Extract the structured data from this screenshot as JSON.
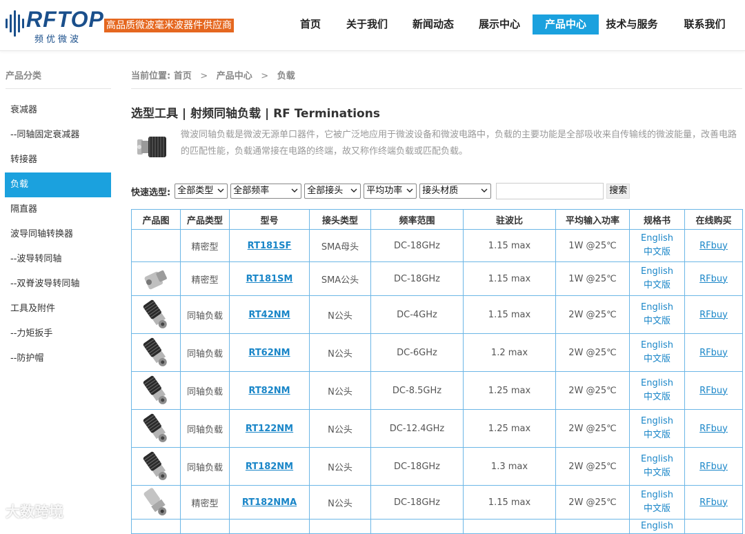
{
  "brand": {
    "logo_text": "RFTOP",
    "logo_sub": "频优微波",
    "slogan": "高品质微波毫米波器件供应商"
  },
  "nav": [
    {
      "label": "首页",
      "active": false
    },
    {
      "label": "关于我们",
      "active": false
    },
    {
      "label": "新闻动态",
      "active": false
    },
    {
      "label": "展示中心",
      "active": false
    },
    {
      "label": "产品中心",
      "active": true
    },
    {
      "label": "技术与服务",
      "active": false
    },
    {
      "label": "联系我们",
      "active": false
    }
  ],
  "sidebar": {
    "title": "产品分类",
    "items": [
      {
        "label": "衰减器",
        "active": false
      },
      {
        "label": "--同轴固定衰减器",
        "active": false
      },
      {
        "label": "转接器",
        "active": false
      },
      {
        "label": "负载",
        "active": true
      },
      {
        "label": "隔直器",
        "active": false
      },
      {
        "label": "波导同轴转换器",
        "active": false
      },
      {
        "label": "--波导转同轴",
        "active": false
      },
      {
        "label": "--双脊波导转同轴",
        "active": false
      },
      {
        "label": "工具及附件",
        "active": false
      },
      {
        "label": "--力矩扳手",
        "active": false
      },
      {
        "label": "--防护帽",
        "active": false
      }
    ]
  },
  "breadcrumb": {
    "prefix": "当前位置:",
    "items": [
      "首页",
      "产品中心",
      "负载"
    ],
    "separator": ">"
  },
  "page": {
    "title": "选型工具 | 射频同轴负载 | RF Terminations",
    "intro": "微波同轴负载是微波无源单口器件，它被广泛地应用于微波设备和微波电路中，负载的主要功能是全部吸收来自传输线的微波能量，改善电路的匹配性能，负载通常接在电路的终端，故又称作终端负载或匹配负载。"
  },
  "filters": {
    "label": "快速选型:",
    "selects": [
      "全部类型",
      "全部频率",
      "全部接头",
      "平均功率",
      "接头材质"
    ],
    "search_value": "",
    "search_button": "搜索"
  },
  "table": {
    "headers": [
      "产品图",
      "产品类型",
      "型号",
      "接头类型",
      "频率范围",
      "驻波比",
      "平均输入功率",
      "规格书",
      "在线购买"
    ],
    "rows": [
      {
        "image": "none",
        "type": "精密型",
        "model": "RT181SF",
        "connector": "SMA母头",
        "freq": "DC-18GHz",
        "vswr": "1.15 max",
        "power": "1W @25℃",
        "spec_en": "English",
        "spec_cn": "中文版",
        "buy": "RFbuy"
      },
      {
        "image": "sma-male-termination-icon",
        "type": "精密型",
        "model": "RT181SM",
        "connector": "SMA公头",
        "freq": "DC-18GHz",
        "vswr": "1.15 max",
        "power": "1W @25℃",
        "spec_en": "English",
        "spec_cn": "中文版",
        "buy": "RFbuy"
      },
      {
        "image": "n-male-termination-icon",
        "type": "同轴负载",
        "model": "RT42NM",
        "connector": "N公头",
        "freq": "DC-4GHz",
        "vswr": "1.15 max",
        "power": "2W @25℃",
        "spec_en": "English",
        "spec_cn": "中文版",
        "buy": "RFbuy"
      },
      {
        "image": "n-male-termination-icon",
        "type": "同轴负载",
        "model": "RT62NM",
        "connector": "N公头",
        "freq": "DC-6GHz",
        "vswr": "1.2 max",
        "power": "2W @25℃",
        "spec_en": "English",
        "spec_cn": "中文版",
        "buy": "RFbuy"
      },
      {
        "image": "n-male-termination-icon",
        "type": "同轴负载",
        "model": "RT82NM",
        "connector": "N公头",
        "freq": "DC-8.5GHz",
        "vswr": "1.25 max",
        "power": "2W @25℃",
        "spec_en": "English",
        "spec_cn": "中文版",
        "buy": "RFbuy"
      },
      {
        "image": "n-male-termination-icon",
        "type": "同轴负载",
        "model": "RT122NM",
        "connector": "N公头",
        "freq": "DC-12.4GHz",
        "vswr": "1.25 max",
        "power": "2W @25℃",
        "spec_en": "English",
        "spec_cn": "中文版",
        "buy": "RFbuy"
      },
      {
        "image": "n-male-termination-icon",
        "type": "同轴负载",
        "model": "RT182NM",
        "connector": "N公头",
        "freq": "DC-18GHz",
        "vswr": "1.3 max",
        "power": "2W @25℃",
        "spec_en": "English",
        "spec_cn": "中文版",
        "buy": "RFbuy"
      },
      {
        "image": "precision-n-termination-icon",
        "type": "精密型",
        "model": "RT182NMA",
        "connector": "N公头",
        "freq": "DC-18GHz",
        "vswr": "1.15 max",
        "power": "2W @25℃",
        "spec_en": "English",
        "spec_cn": "中文版",
        "buy": "RFbuy"
      },
      {
        "image": "none",
        "type": "",
        "model": "",
        "connector": "",
        "freq": "",
        "vswr": "",
        "power": "",
        "spec_en": "English",
        "spec_cn": "",
        "buy": ""
      }
    ]
  },
  "watermark": "大数跨境",
  "colors": {
    "accent": "#1ba1de",
    "brand": "#1a4f8b",
    "slogan_bg": "#e5671f",
    "link": "#1a86c8",
    "table_border": "#6bb6e6"
  }
}
